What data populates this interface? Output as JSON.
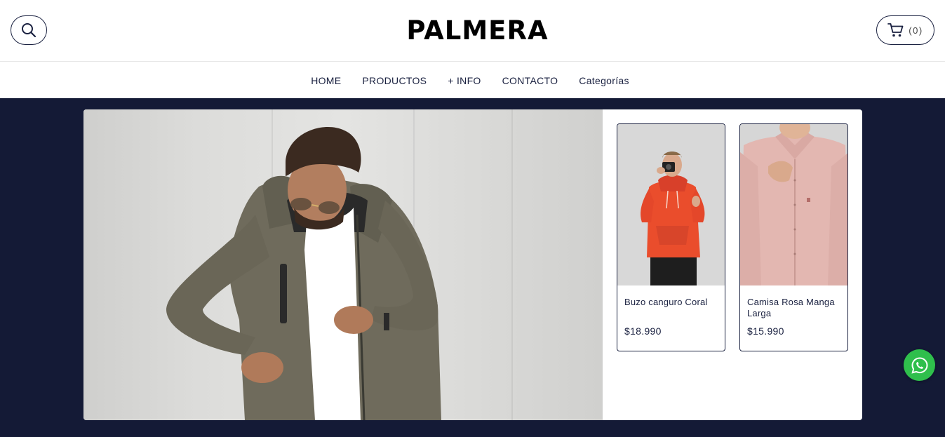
{
  "header": {
    "logo_text": "PALMERA",
    "cart_count": "(0)",
    "icons": {
      "search": "search-icon",
      "cart": "cart-icon"
    }
  },
  "nav": {
    "items": [
      {
        "label": "HOME"
      },
      {
        "label": "PRODUCTOS"
      },
      {
        "label": "+ INFO"
      },
      {
        "label": "CONTACTO"
      },
      {
        "label": "Categorías"
      }
    ]
  },
  "featured_products": [
    {
      "name": "Buzo canguro Coral",
      "price": "$18.990"
    },
    {
      "name": "Camisa Rosa Manga Larga",
      "price": "$15.990"
    }
  ],
  "floating": {
    "whatsapp_icon": "whatsapp-icon"
  },
  "colors": {
    "brand_navy": "#141a36",
    "text_navy": "#1a2140",
    "whatsapp_green": "#2fbf4c",
    "hoodie_coral": "#ea4d2c",
    "shirt_pink": "#e3b7b1"
  }
}
